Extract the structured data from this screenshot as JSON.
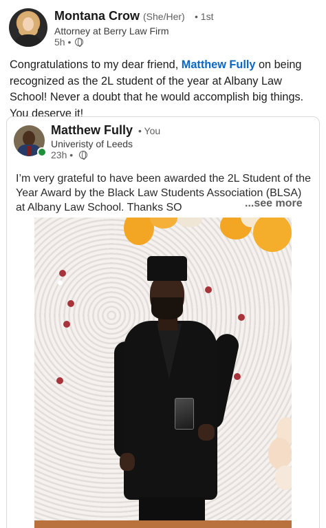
{
  "post": {
    "author": {
      "name": "Montana Crow",
      "pronouns": "(She/Her)",
      "degree": "• 1st",
      "headline": "Attorney at Berry Law Firm",
      "time": "5h •",
      "visibility_icon": "globe-icon"
    },
    "text_before_mention": "Congratulations to my dear friend, ",
    "mention": "Matthew Fully",
    "text_after_mention": " on being recognized as the 2L student of the year at Albany Law School! Never a doubt that he would accomplish big things. You deserve it!",
    "mention_color": "#0a66c2"
  },
  "quoted_post": {
    "author": {
      "name": "Matthew Fully",
      "relation": "• You",
      "headline": "Univeristy of Leeds",
      "time": "23h •",
      "visibility_icon": "globe-icon",
      "online_status_color": "#1f8f3a"
    },
    "text": "I’m very grateful to have been awarded the 2L Student of the Year Award by the Black Law Students Association (BLSA) at Albany Law School. Thanks SO",
    "see_more_label": "...see more"
  }
}
